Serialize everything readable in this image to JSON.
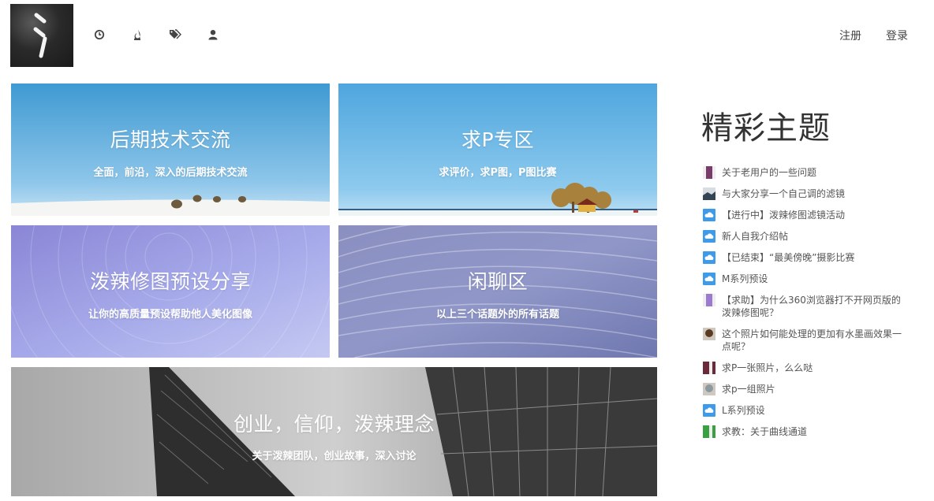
{
  "header": {
    "nav_icons": [
      "clock-icon",
      "fire-icon",
      "tags-icon",
      "user-icon"
    ],
    "register_label": "注册",
    "login_label": "登录"
  },
  "tiles": [
    {
      "title": "后期技术交流",
      "subtitle": "全面，前沿，深入的后期技术交流"
    },
    {
      "title": "求P专区",
      "subtitle": "求评价，求P图，P图比赛"
    },
    {
      "title": "泼辣修图预设分享",
      "subtitle": "让你的高质量预设帮助他人美化图像"
    },
    {
      "title": "闲聊区",
      "subtitle": "以上三个话题外的所有话题"
    },
    {
      "title": "创业，信仰，泼辣理念",
      "subtitle": "关于泼辣团队，创业故事，深入讨论"
    }
  ],
  "sidebar": {
    "title": "精彩主题",
    "topics": [
      {
        "text": "关于老用户的一些问题",
        "avatar": "pixel-avatar",
        "color": "#7a3a6a"
      },
      {
        "text": "与大家分享一个自己调的滤镜",
        "avatar": "landscape-avatar",
        "color": "#334455"
      },
      {
        "text": "【进行中】泼辣修图滤镜活动",
        "avatar": "cloud-icon",
        "color": "#3d9be9"
      },
      {
        "text": "新人自我介绍帖",
        "avatar": "cloud-icon",
        "color": "#3d9be9"
      },
      {
        "text": "【已结束】“最美傍晚”摄影比赛",
        "avatar": "cloud-icon",
        "color": "#3d9be9"
      },
      {
        "text": "M系列预设",
        "avatar": "cloud-icon",
        "color": "#3d9be9"
      },
      {
        "text": "【求助】为什么360浏览器打不开网页版的泼辣修图呢？",
        "avatar": "pixel-avatar",
        "color": "#9b7ad0"
      },
      {
        "text": "这个照片如何能处理的更加有水墨画效果一点呢？",
        "avatar": "photo-avatar",
        "color": "#5a3a20"
      },
      {
        "text": "求P一张照片，么么哒",
        "avatar": "pixel-avatar",
        "color": "#6a2a3a"
      },
      {
        "text": "求p一组照片",
        "avatar": "photo-avatar",
        "color": "#8a9aa0"
      },
      {
        "text": "L系列预设",
        "avatar": "cloud-icon",
        "color": "#3d9be9"
      },
      {
        "text": "求教：关于曲线通道",
        "avatar": "pixel-avatar",
        "color": "#3aa040"
      }
    ]
  }
}
